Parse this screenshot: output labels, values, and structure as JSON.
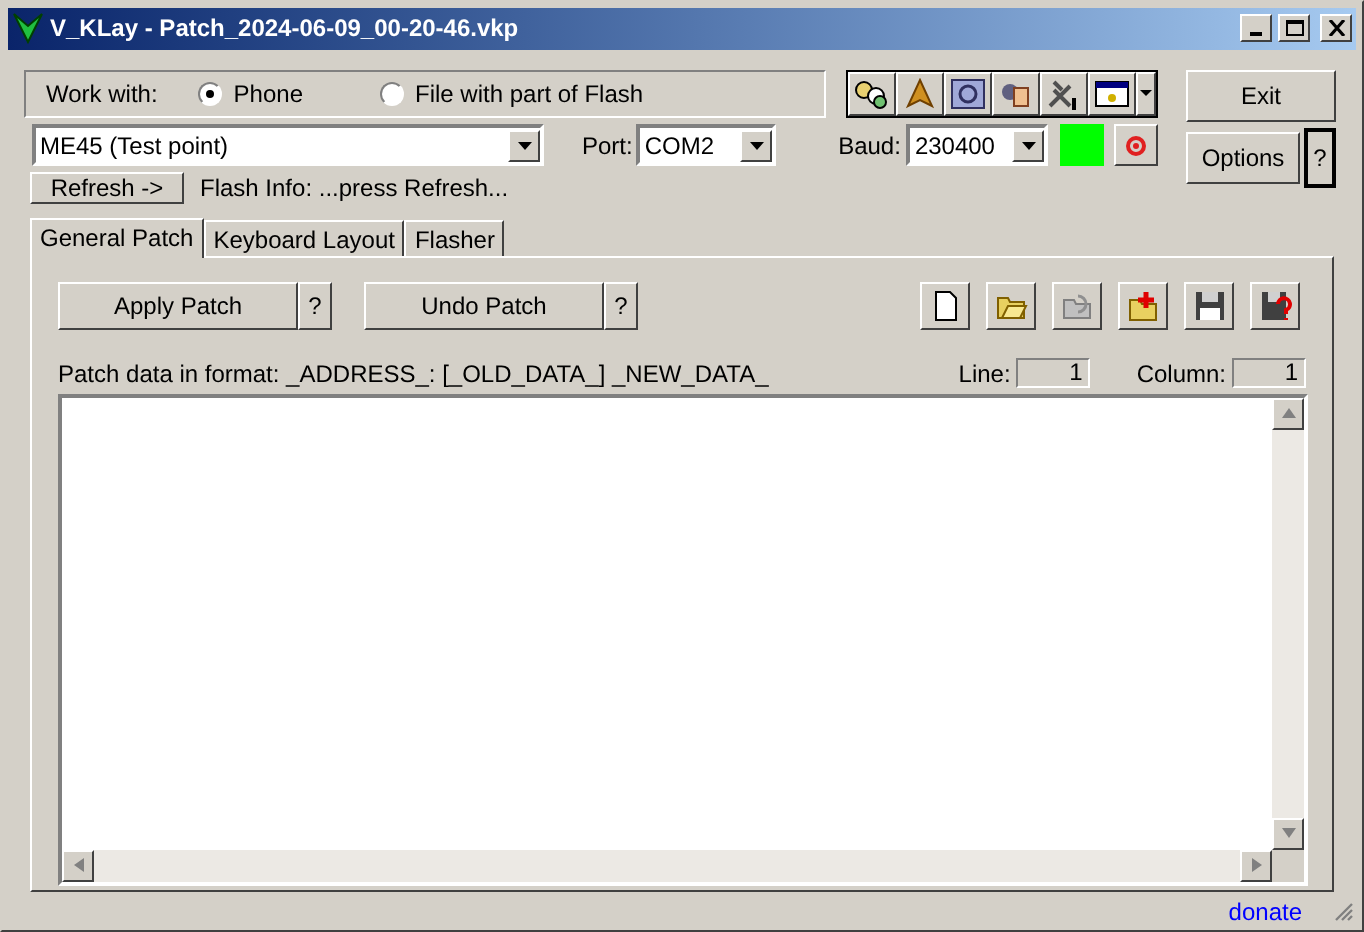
{
  "window": {
    "title": "V_KLay - Patch_2024-06-09_00-20-46.vkp"
  },
  "work_with": {
    "label": "Work with:",
    "options": [
      {
        "label": "Phone",
        "selected": true
      },
      {
        "label": "File with part of Flash",
        "selected": false
      }
    ]
  },
  "device": {
    "value": "ME45 (Test point)"
  },
  "port": {
    "label": "Port:",
    "value": "COM2"
  },
  "baud": {
    "label": "Baud:",
    "value": "230400"
  },
  "connected": true,
  "refresh_button": "Refresh ->",
  "flash_info": "Flash Info: ...press Refresh...",
  "exit_button": "Exit",
  "options_button": "Options",
  "help_button": "?",
  "tabs": [
    {
      "label": "General Patch",
      "selected": true
    },
    {
      "label": "Keyboard Layout",
      "selected": false
    },
    {
      "label": "Flasher",
      "selected": false
    }
  ],
  "patch_buttons": [
    {
      "label": "Apply Patch",
      "help": "?"
    },
    {
      "label": "Undo Patch",
      "help": "?"
    }
  ],
  "format_hint": "Patch data in format: _ADDRESS_: [_OLD_DATA_] _NEW_DATA_",
  "line": {
    "label": "Line:",
    "value": "1"
  },
  "column": {
    "label": "Column:",
    "value": "1"
  },
  "status_bar": {
    "link": "donate"
  }
}
